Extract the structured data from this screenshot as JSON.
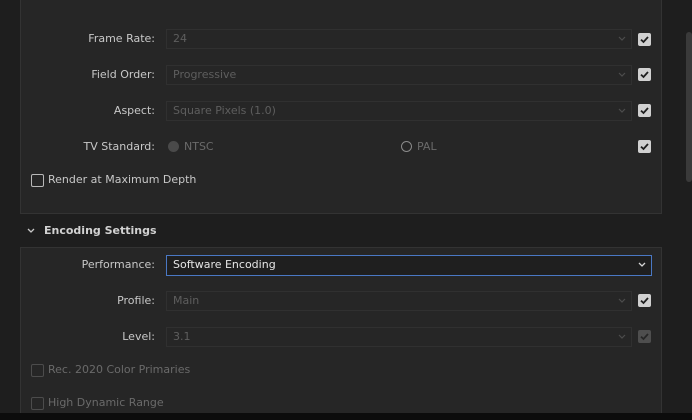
{
  "video_settings": {
    "frame_rate": {
      "label": "Frame Rate:",
      "value": "24"
    },
    "field_order": {
      "label": "Field Order:",
      "value": "Progressive"
    },
    "aspect": {
      "label": "Aspect:",
      "value": "Square Pixels (1.0)"
    },
    "tv_standard": {
      "label": "TV Standard:",
      "options": [
        {
          "label": "NTSC",
          "selected": true
        },
        {
          "label": "PAL",
          "selected": false
        }
      ]
    },
    "render_max_depth": {
      "label": "Render at Maximum Depth",
      "checked": false
    }
  },
  "encoding_settings": {
    "title": "Encoding Settings",
    "performance": {
      "label": "Performance:",
      "value": "Software Encoding"
    },
    "profile": {
      "label": "Profile:",
      "value": "Main"
    },
    "level": {
      "label": "Level:",
      "value": "3.1"
    },
    "rec2020": {
      "label": "Rec. 2020 Color Primaries",
      "checked": false,
      "enabled": false
    },
    "hdr": {
      "label": "High Dynamic Range",
      "checked": false,
      "enabled": false
    }
  },
  "colors": {
    "background": "#1e1e1e",
    "panel": "#262626",
    "focus_border": "#4a78c4"
  }
}
